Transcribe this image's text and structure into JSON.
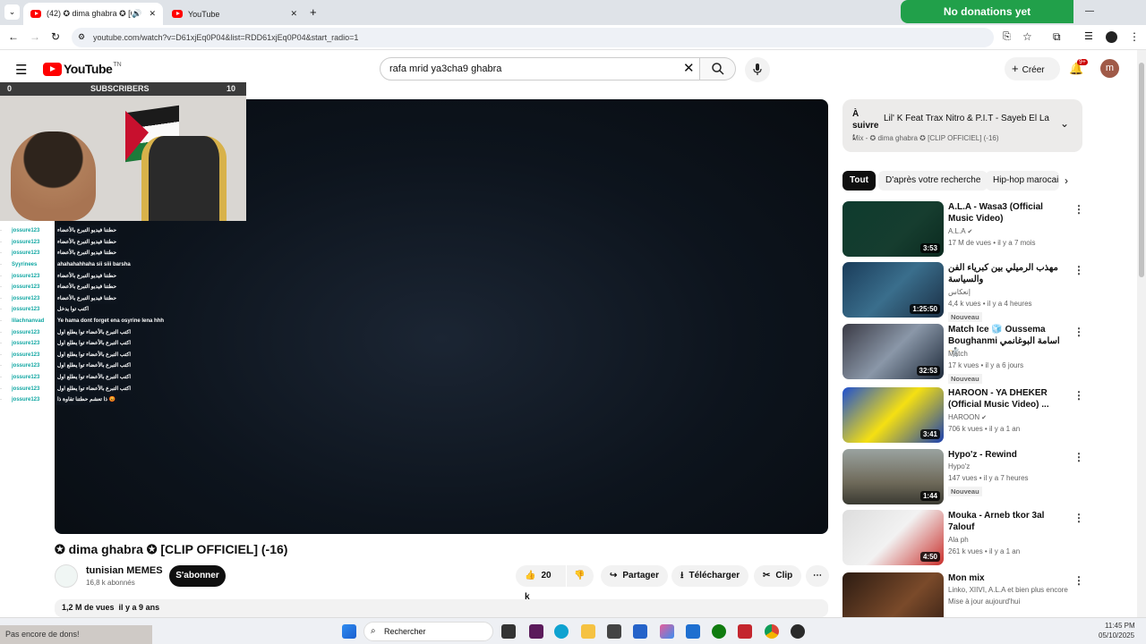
{
  "browser": {
    "tabs": [
      {
        "title": "(42) ✪ dima ghabra ✪ [CLIP",
        "active": true
      },
      {
        "title": "YouTube",
        "active": false
      }
    ],
    "url": "youtube.com/watch?v=D61xjEq0P04&list=RDD61xjEq0P04&start_radio=1"
  },
  "overlay": {
    "donations_top": "No donations yet",
    "donations_bottom": "Pas encore de dons!",
    "subscribers_left": "0",
    "subscribers_label": "SUBSCRIBERS",
    "subscribers_right": "10"
  },
  "chat": [
    {
      "user": "jossure123",
      "msg": "حطتنا فيديو التبرع بالأعضاء"
    },
    {
      "user": "jossure123",
      "msg": "حطتنا فيديو التبرع بالأعضاء"
    },
    {
      "user": "jossure123",
      "msg": "حطتنا فيديو التبرع بالأعضاء"
    },
    {
      "user": "Syyrinees",
      "msg": "ahahahahhaha sii siii barsha"
    },
    {
      "user": "jossure123",
      "msg": "حطتنا فيديو التبرع بالأعضاء"
    },
    {
      "user": "jossure123",
      "msg": "حطتنا فيديو التبرع بالأعضاء"
    },
    {
      "user": "jossure123",
      "msg": "حطتنا فيديو التبرع بالأعضاء"
    },
    {
      "user": "jossure123",
      "msg": "اكتب توا يدخل"
    },
    {
      "user": "lilachnanvad",
      "msg": "Ye hama dont forget ena osyrine lena hhh"
    },
    {
      "user": "jossure123",
      "msg": "اكتب التبرع بالأعضاء توا يطلع اول"
    },
    {
      "user": "jossure123",
      "msg": "اكتب التبرع بالأعضاء توا يطلع اول"
    },
    {
      "user": "jossure123",
      "msg": "اكتب التبرع بالأعضاء توا يطلع اول"
    },
    {
      "user": "jossure123",
      "msg": "اكتب التبرع بالأعضاء توا يطلع اول"
    },
    {
      "user": "jossure123",
      "msg": "اكتب التبرع بالأعضاء توا يطلع اول"
    },
    {
      "user": "jossure123",
      "msg": "اكتب التبرع بالأعضاء توا يطلع اول"
    },
    {
      "user": "jossure123",
      "msg": "ذا تعشم حطتنا تقاوة ذا 😡"
    }
  ],
  "youtube": {
    "logo": "YouTube",
    "logo_region": "TN",
    "search_query": "rafa mrid ya3cha9 ghabra",
    "create_label": "Créer",
    "notif_badge": "9+",
    "avatar_letter": "m",
    "video_title": "✪ dima ghabra ✪ [CLIP OFFICIEL] (-16)",
    "channel_name": "tunisian MEMES",
    "channel_subs": "16,8 k abonnés",
    "subscribe_label": "S'abonner",
    "likes": "20 k",
    "share_label": "Partager",
    "download_label": "Télécharger",
    "clip_label": "Clip",
    "desc_views": "1,2 M de vues",
    "desc_date": "il y a 9 ans",
    "up_next_prefix": "À suivre :",
    "up_next_title": "Lil' K Feat Trax Nitro & P.I.T - Sayeb El La3b...",
    "up_next_sub": "Mix - ✪ dima ghabra ✪ [CLIP OFFICIEL] (-16)",
    "chips": [
      "Tout",
      "D'après votre recherche",
      "Hip-hop marocain"
    ],
    "recommendations": [
      {
        "title": "A.L.A - Wasa3 (Official Music Video)",
        "channel": "A.L.A",
        "verified": true,
        "meta": "17 M de vues • il y a 7 mois",
        "duration": "3:53",
        "badge": ""
      },
      {
        "title": "مهذب الرميلي بين كبرياء الفن والسياسة",
        "channel": "إنعكاس",
        "verified": false,
        "meta": "4,4 k vues • il y a 4 heures",
        "duration": "1:25:50",
        "badge": "Nouveau"
      },
      {
        "title": "Match Ice 🧊 Oussema Boughanmi اسامة البوغانمي 🤺",
        "channel": "Match",
        "verified": false,
        "meta": "17 k vues • il y a 6 jours",
        "duration": "32:53",
        "badge": "Nouveau"
      },
      {
        "title": "HAROON - YA DHEKER (Official Music Video) ...",
        "channel": "HAROON",
        "verified": true,
        "meta": "706 k vues • il y a 1 an",
        "duration": "3:41",
        "badge": ""
      },
      {
        "title": "Hypo'z - Rewind",
        "channel": "Hypo'z",
        "verified": false,
        "meta": "147 vues • il y a 7 heures",
        "duration": "1:44",
        "badge": "Nouveau"
      },
      {
        "title": "Mouka - Arneb tkor 3al 7alouf",
        "channel": "Ala ph",
        "verified": false,
        "meta": "261 k vues • il y a 1 an",
        "duration": "4:50",
        "badge": ""
      },
      {
        "title": "Mon mix",
        "channel": "Linko, XIIVI, A.L.A et bien plus encore",
        "verified": false,
        "meta": "Mise à jour aujourd'hui",
        "duration": "",
        "badge": ""
      }
    ]
  },
  "taskbar": {
    "search_placeholder": "Rechercher",
    "time": "11:45 PM",
    "date": "05/10/2025"
  }
}
